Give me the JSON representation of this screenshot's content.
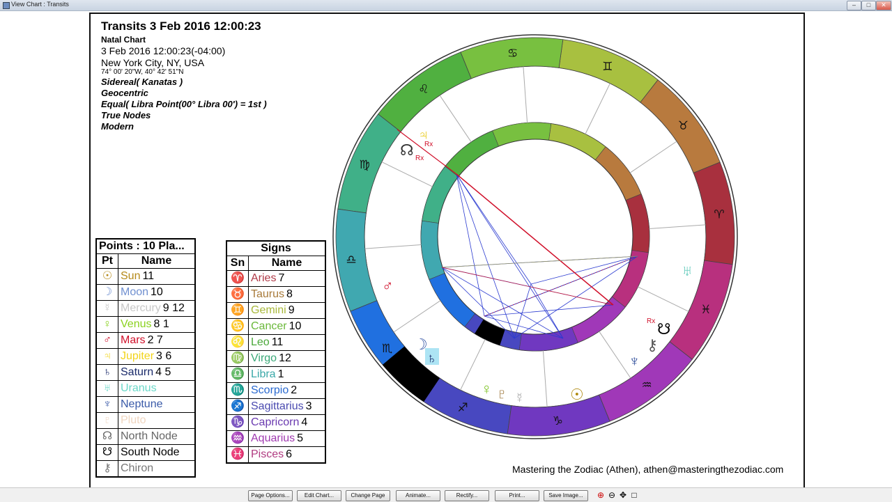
{
  "window": {
    "title": "View Chart : Transits",
    "min": "–",
    "max": "□",
    "close": "✕"
  },
  "header": {
    "title": "Transits 3 Feb 2016 12:00:23",
    "subtitle": "Natal Chart",
    "datetime": "3 Feb 2016 12:00:23(-04:00)",
    "location": "New York City, NY, USA",
    "coords": "74° 00' 20\"W, 40° 42' 51\"N",
    "zodiac": "Sidereal( Kanatas )",
    "center": "Geocentric",
    "houses": "Equal( Libra Point(00° Libra 00') = 1st )",
    "nodes": "True Nodes",
    "mode": "Modern"
  },
  "points_table": {
    "title": "Points : 10 Pla...",
    "col_pt": "Pt",
    "col_name": "Name",
    "rows": [
      {
        "glyph": "☉",
        "name": "Sun",
        "houses": "11",
        "color": "#b58a1a"
      },
      {
        "glyph": "☽",
        "name": "Moon",
        "houses": "10",
        "color": "#6f8fd0"
      },
      {
        "glyph": "☿",
        "name": "Mercury",
        "houses": "9 12",
        "color": "#c8c8c8"
      },
      {
        "glyph": "♀",
        "name": "Venus",
        "houses": "8  1",
        "color": "#8ad21e"
      },
      {
        "glyph": "♂",
        "name": "Mars",
        "houses": "2 7",
        "color": "#d0102a"
      },
      {
        "glyph": "♃",
        "name": "Jupiter",
        "houses": "3 6",
        "color": "#f2d41a"
      },
      {
        "glyph": "♄",
        "name": "Saturn",
        "houses": "4  5",
        "color": "#1a2a6a"
      },
      {
        "glyph": "♅",
        "name": "Uranus",
        "houses": "",
        "color": "#6ad8c8"
      },
      {
        "glyph": "♆",
        "name": "Neptune",
        "houses": "",
        "color": "#3a5aa8"
      },
      {
        "glyph": "♇",
        "name": "Pluto",
        "houses": "",
        "color": "#f0d6c0"
      },
      {
        "glyph": "☊",
        "name": "North Node",
        "houses": "",
        "color": "#666666"
      },
      {
        "glyph": "☋",
        "name": "South Node",
        "houses": "",
        "color": "#000000"
      },
      {
        "glyph": "⚷",
        "name": "Chiron",
        "houses": "",
        "color": "#777777"
      }
    ]
  },
  "signs_table": {
    "title": "Signs",
    "col_sn": "Sn",
    "col_name": "Name",
    "rows": [
      {
        "glyph": "♈",
        "name": "Aries",
        "num": "7",
        "color": "#b03a48"
      },
      {
        "glyph": "♉",
        "name": "Taurus",
        "num": "8",
        "color": "#a87a3a"
      },
      {
        "glyph": "♊",
        "name": "Gemini",
        "num": "9",
        "color": "#a8b83a"
      },
      {
        "glyph": "♋",
        "name": "Cancer",
        "num": "10",
        "color": "#6ab83a"
      },
      {
        "glyph": "♌",
        "name": "Leo",
        "num": "11",
        "color": "#4aa83a"
      },
      {
        "glyph": "♍",
        "name": "Virgo",
        "num": "12",
        "color": "#3aa878"
      },
      {
        "glyph": "♎",
        "name": "Libra",
        "num": "1",
        "color": "#3aa8a8"
      },
      {
        "glyph": "♏",
        "name": "Scorpio",
        "num": "2",
        "color": "#2a6ad0"
      },
      {
        "glyph": "♐",
        "name": "Sagittarius",
        "num": "3",
        "color": "#4a4ab0"
      },
      {
        "glyph": "♑",
        "name": "Capricorn",
        "num": "4",
        "color": "#6a3ab0"
      },
      {
        "glyph": "♒",
        "name": "Aquarius",
        "num": "5",
        "color": "#a03ab0"
      },
      {
        "glyph": "♓",
        "name": "Pisces",
        "num": "6",
        "color": "#b03a80"
      }
    ]
  },
  "wheel": {
    "sign_glyphs": [
      "♈",
      "♉",
      "♊",
      "♋",
      "♌",
      "♍",
      "♎",
      "♏",
      "♐",
      "♑",
      "♒",
      "♓"
    ],
    "retro_mark": "Rx"
  },
  "footer": {
    "credit": "Mastering the Zodiac (Athen), athen@masteringthezodiac.com"
  },
  "toolbar": {
    "page_options": "Page Options...",
    "edit_chart": "Edit Chart...",
    "change_page": "Change Page",
    "animate": "Animate...",
    "rectify": "Rectify...",
    "print": "Print...",
    "save_image": "Save Image...",
    "zoom_in": "⊕",
    "zoom_out": "⊖",
    "pan": "✥",
    "fit": "□"
  }
}
